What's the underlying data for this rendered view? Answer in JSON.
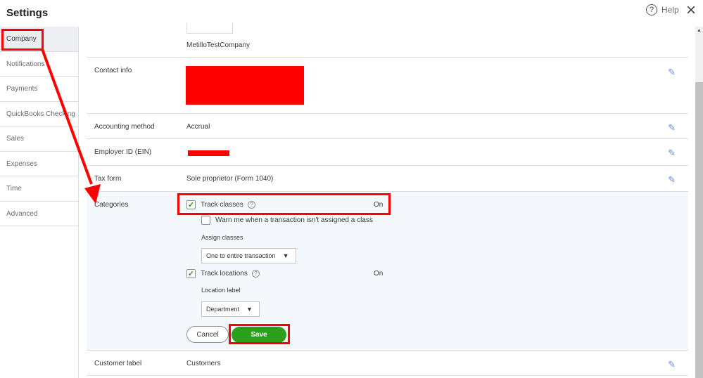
{
  "header": {
    "title": "Settings",
    "help_label": "Help",
    "close": "×"
  },
  "sidebar": {
    "items": [
      {
        "label": "Company",
        "active": true
      },
      {
        "label": "Notifications"
      },
      {
        "label": "Payments"
      },
      {
        "label": "QuickBooks Checking"
      },
      {
        "label": "Sales"
      },
      {
        "label": "Expenses"
      },
      {
        "label": "Time"
      },
      {
        "label": "Advanced"
      }
    ]
  },
  "company": {
    "name": "MetilloTestCompany"
  },
  "rows": {
    "contact": {
      "label": "Contact info"
    },
    "accounting": {
      "label": "Accounting method",
      "value": "Accrual"
    },
    "ein": {
      "label": "Employer ID (EIN)"
    },
    "tax": {
      "label": "Tax form",
      "value": "Sole proprietor (Form 1040)"
    },
    "customer": {
      "label": "Customer label",
      "value": "Customers"
    }
  },
  "categories": {
    "label": "Categories",
    "track_classes": "Track classes",
    "track_classes_status": "On",
    "warn": "Warn me when a transaction isn't assigned a class",
    "assign_label": "Assign classes",
    "assign_value": "One to entire transaction",
    "track_locations": "Track locations",
    "track_locations_status": "On",
    "location_label": "Location label",
    "location_value": "Department",
    "cancel": "Cancel",
    "save": "Save"
  },
  "colors": {
    "accent": "#2ca01c",
    "annotation": "#ff0000"
  }
}
